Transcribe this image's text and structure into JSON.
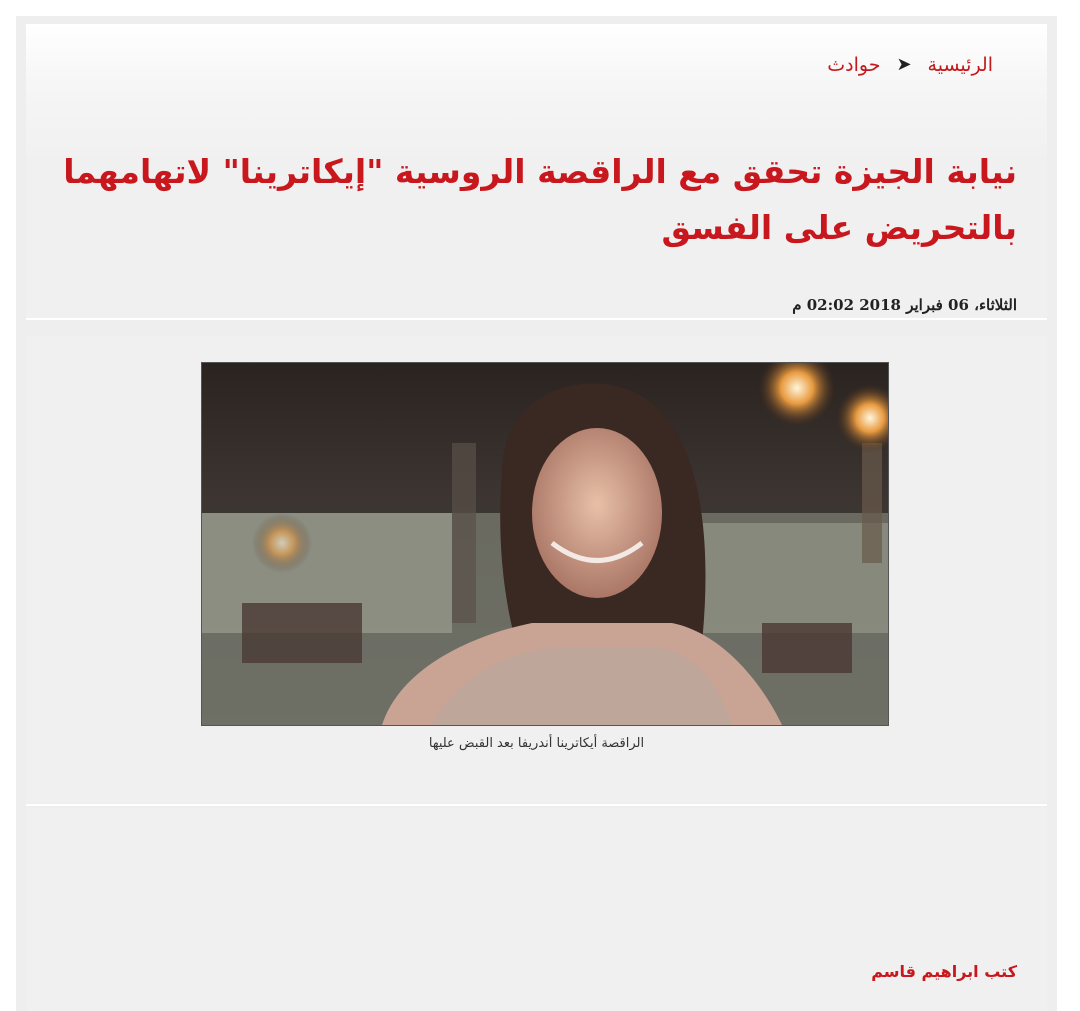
{
  "breadcrumb": {
    "home": "الرئيسية",
    "separator_icon": "chevron-left-icon",
    "section": "حوادث"
  },
  "article": {
    "headline": "نيابة الجيزة تحقق مع الراقصة الروسية \"إيكاترينا\" لاتهامهما بالتحريض على الفسق",
    "dateline": "الثلاثاء، 06 فبراير 2018 02:02 م",
    "image_caption": "الراقصة أيكاترينا أندريفا بعد القبض عليها",
    "author": "كتب ابراهيم قاسم"
  },
  "colors": {
    "accent_red": "#c8181e",
    "panel_bg": "#f0f0f0"
  }
}
